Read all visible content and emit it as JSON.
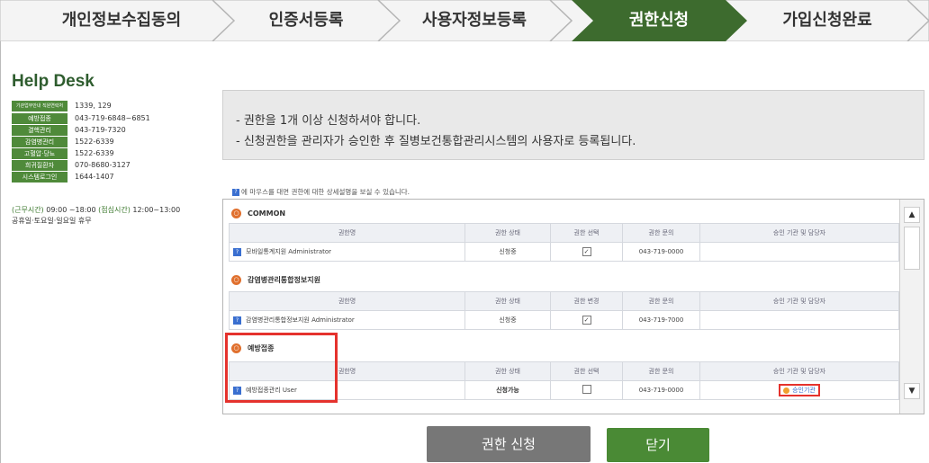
{
  "steps": {
    "items": [
      {
        "label": "개인정보수집동의"
      },
      {
        "label": "인증서등록"
      },
      {
        "label": "사용자정보등록"
      },
      {
        "label": "권한신청"
      },
      {
        "label": "가입신청완료"
      }
    ],
    "active_index": 3,
    "active_color": "#3d6b2e"
  },
  "helpdesk": {
    "title": "Help Desk",
    "rows": [
      {
        "tag": "기관업무안내 직원연락처",
        "value": "1339, 129"
      },
      {
        "tag": "예방접종",
        "value": "043-719-6848~6851"
      },
      {
        "tag": "결핵관리",
        "value": "043-719-7320"
      },
      {
        "tag": "감염병관리",
        "value": "1522-6339"
      },
      {
        "tag": "고혈압·당뇨",
        "value": "1522-6339"
      },
      {
        "tag": "희귀질환자",
        "value": "070-8680-3127"
      },
      {
        "tag": "시스템로그인",
        "value": "1644-1407"
      }
    ],
    "hours_label": "(근무시간)",
    "hours_value": "09:00 ~18:00",
    "lunch_label": "(점심시간)",
    "lunch_value": "12:00~13:00",
    "holiday": "공휴일·토요일·일요일 휴무"
  },
  "notice": {
    "line1": "- 권한을 1개 이상 신청하셔야 합니다.",
    "line2": "- 신청권한을 관리자가 승인한 후 질병보건통합관리시스템의 사용자로 등록됩니다."
  },
  "hint": "에 마우스를 대면 권한에 대한 상세설명을 보실 수 있습니다.",
  "sections": [
    {
      "title": "COMMON",
      "headers": [
        "권한명",
        "권한 상태",
        "권한 선택",
        "권한 문의",
        "승인 기관 및 담당자"
      ],
      "row": {
        "name": "모바일통계지원 Administrator",
        "status": "신청중",
        "select": "✓",
        "contact": "043-719-0000",
        "approver": ""
      }
    },
    {
      "title": "감염병관리통합정보지원",
      "headers": [
        "권한명",
        "권한 상태",
        "권한 변경",
        "권한 문의",
        "승인 기관 및 담당자"
      ],
      "row": {
        "name": "감염병관리통합정보지원 Administrator",
        "status": "신청중",
        "select": "✓",
        "contact": "043-719-7000",
        "approver": ""
      }
    },
    {
      "title": "예방접종",
      "headers": [
        "권한명",
        "권한 상태",
        "권한 선택",
        "권한 문의",
        "승인 기관 및 담당자"
      ],
      "row": {
        "name": "예방접종관리 User",
        "status": "신청가능",
        "select": "",
        "contact": "043-719-0000",
        "approver": "승인기관"
      }
    }
  ],
  "buttons": {
    "apply": "권한 신청",
    "close": "닫기"
  },
  "colors": {
    "brand_green": "#4a8a35",
    "highlight_red": "#e5322d",
    "status_orange": "#e08a2a"
  }
}
